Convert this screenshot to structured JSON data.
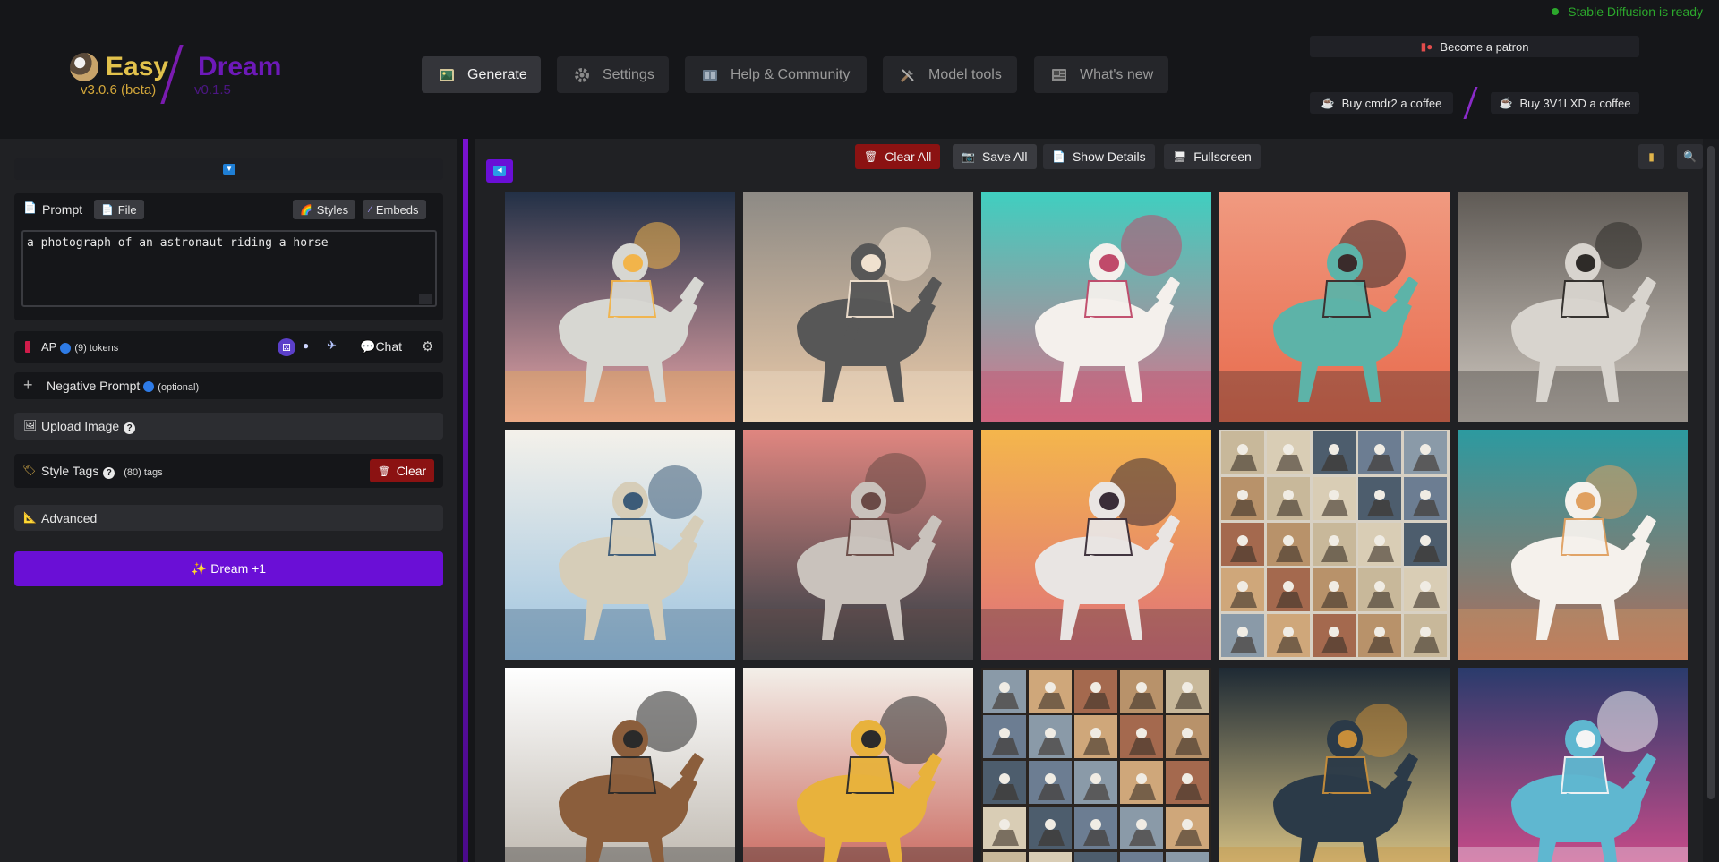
{
  "header": {
    "logo_easy": "Easy",
    "logo_easy_version": "v3.0.6 (beta)",
    "logo_dream": "Dream",
    "logo_dream_version": "v0.1.5",
    "tabs": [
      {
        "label": "Generate",
        "icon": "image-icon",
        "active": true
      },
      {
        "label": "Settings",
        "icon": "gear-icon",
        "active": false
      },
      {
        "label": "Help & Community",
        "icon": "book-icon",
        "active": false
      },
      {
        "label": "Model tools",
        "icon": "tools-icon",
        "active": false
      },
      {
        "label": "What's new",
        "icon": "news-icon",
        "active": false
      }
    ],
    "status": "Stable Diffusion is ready",
    "patron_label": "Become a patron",
    "coffee1_label": "Buy cmdr2 a coffee",
    "coffee2_label": "Buy 3V1LXD a coffee"
  },
  "left": {
    "prompt_label": "Prompt",
    "file_label": "File",
    "styles_label": "Styles",
    "embeds_label": "Embeds",
    "prompt_text": "a photograph of an astronaut riding a horse",
    "ap_label": "AP",
    "tokens_label": "(9) tokens",
    "chat_label": "Chat",
    "negative_label": "Negative Prompt",
    "optional_label": "(optional)",
    "upload_label": "Upload Image",
    "style_tags_label": "Style Tags",
    "tags_count": "(80) tags",
    "clear_label": "Clear",
    "advanced_label": "Advanced",
    "dream_label": "✨ Dream +1"
  },
  "gallery": {
    "clear_all_label": "Clear All",
    "save_all_label": "Save All",
    "show_details_label": "Show Details",
    "fullscreen_label": "Fullscreen",
    "images": [
      "astronaut-horse-1",
      "astronaut-horse-2",
      "astronaut-horse-3",
      "astronaut-horse-4",
      "astronaut-horse-5",
      "astronaut-horse-6",
      "astronaut-horse-7",
      "astronaut-horse-8",
      "astronaut-horse-grid-9",
      "astronaut-horse-10",
      "astronaut-horse-11",
      "astronaut-horse-12",
      "astronaut-horse-grid-13",
      "astronaut-horse-14",
      "astronaut-horse-15"
    ]
  },
  "colors": {
    "accent": "#6a0fd6",
    "status_green": "#2ca82c",
    "clear_red": "#8b1212"
  }
}
